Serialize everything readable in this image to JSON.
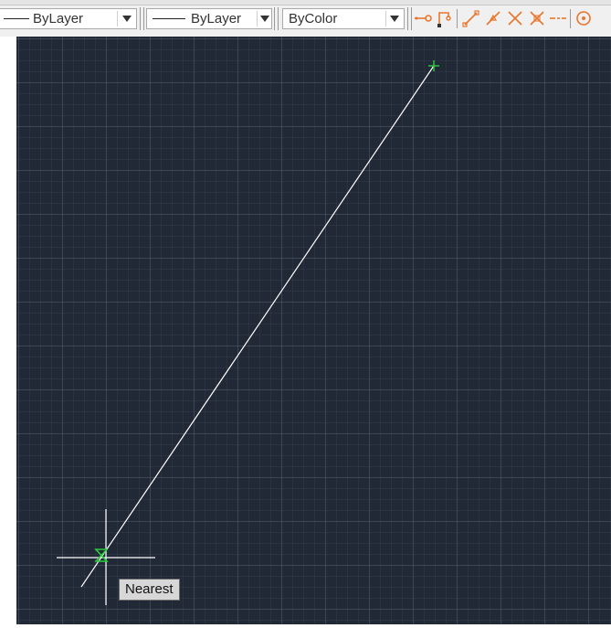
{
  "toolbar": {
    "linetype": {
      "value": "ByLayer",
      "icon": "linetype-dropdown-arrow-icon"
    },
    "lineweight": {
      "value": "ByLayer",
      "icon": "lineweight-dropdown-arrow-icon"
    },
    "plotstyle": {
      "value": "ByColor",
      "icon": "plotstyle-dropdown-arrow-icon"
    },
    "snap_tools": [
      "temporary-track-point-icon",
      "snap-from-icon",
      "snap-endpoint-icon",
      "snap-midpoint-icon",
      "snap-intersection-icon",
      "snap-apparent-intersection-icon",
      "snap-extension-icon",
      "snap-center-icon"
    ],
    "icon_color": "#e8762c"
  },
  "canvas": {
    "background": "#212836",
    "line_color": "#ffffff",
    "snap_marker_color": "#2ecc40",
    "cursor_color": "#ffffff"
  },
  "osnap_tooltip": {
    "label": "Nearest"
  }
}
